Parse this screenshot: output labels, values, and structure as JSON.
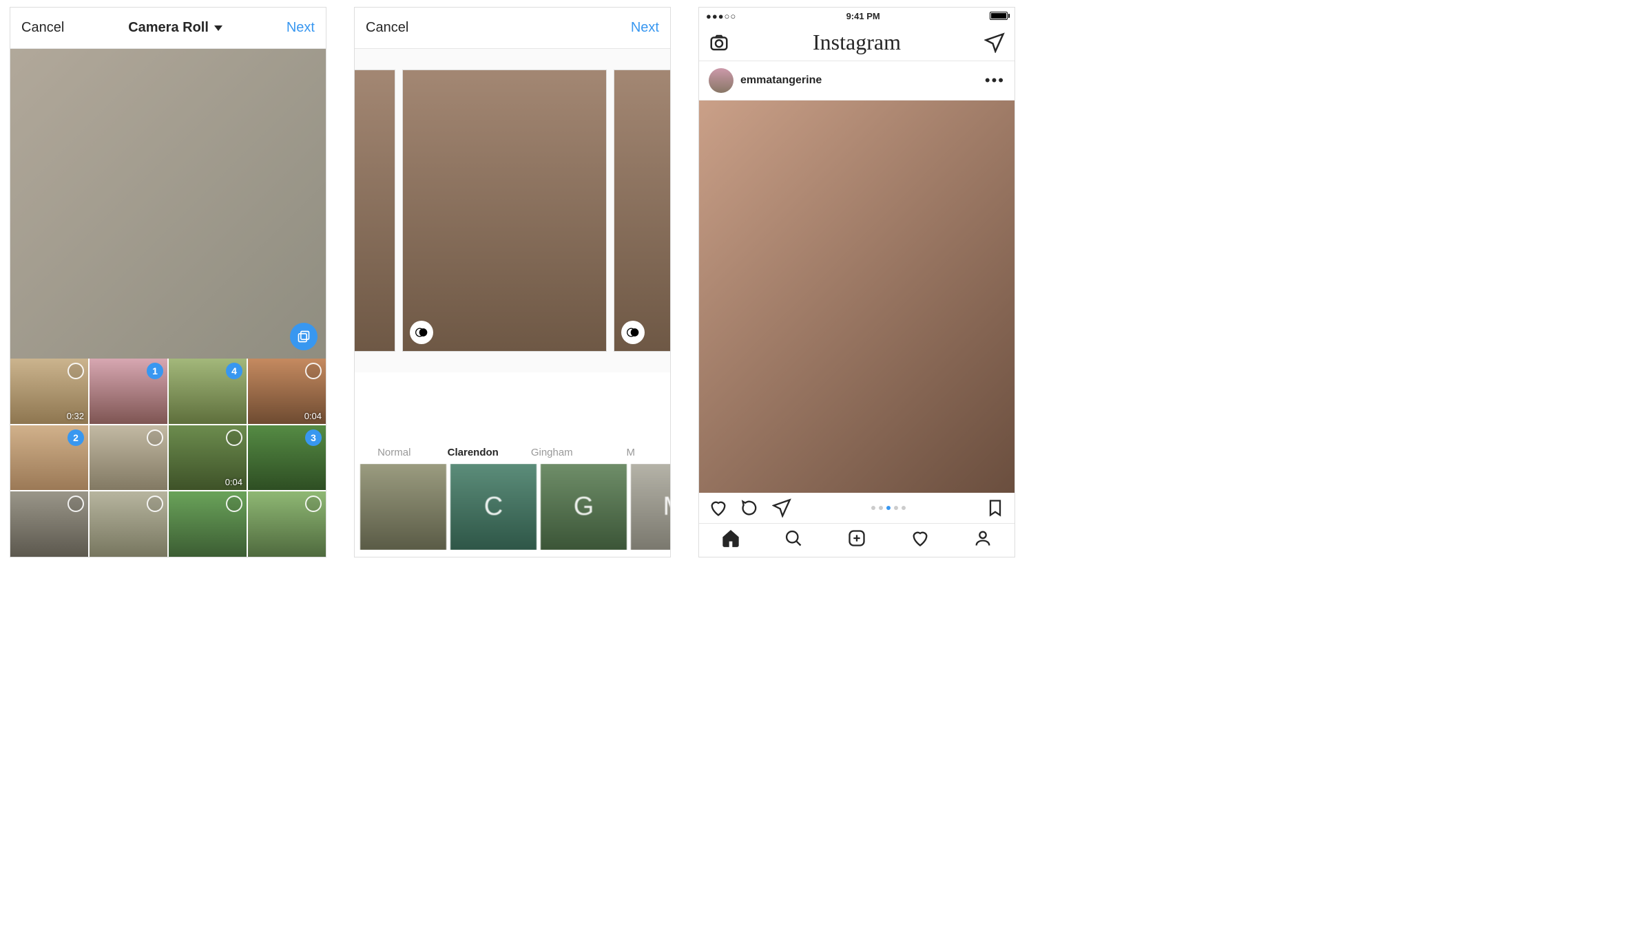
{
  "screen1": {
    "cancel": "Cancel",
    "title": "Camera Roll",
    "next": "Next",
    "grid": [
      {
        "dur": "0:32",
        "sel": null
      },
      {
        "dur": null,
        "sel": 1
      },
      {
        "dur": null,
        "sel": 4
      },
      {
        "dur": "0:04",
        "sel": null
      },
      {
        "dur": null,
        "sel": 2
      },
      {
        "dur": null,
        "sel": null
      },
      {
        "dur": "0:04",
        "sel": null
      },
      {
        "dur": null,
        "sel": 3
      },
      {
        "dur": null,
        "sel": null
      },
      {
        "dur": null,
        "sel": null
      },
      {
        "dur": null,
        "sel": null
      },
      {
        "dur": null,
        "sel": null
      }
    ]
  },
  "screen2": {
    "cancel": "Cancel",
    "next": "Next",
    "filters": [
      {
        "label": "Normal",
        "glyph": ""
      },
      {
        "label": "Clarendon",
        "glyph": "C"
      },
      {
        "label": "Gingham",
        "glyph": "G"
      },
      {
        "label": "M",
        "glyph": "M"
      }
    ],
    "active_filter_index": 1
  },
  "screen3": {
    "status_time": "9:41 PM",
    "signal_dots": "●●●○○",
    "app_name": "Instagram",
    "username": "emmatangerine",
    "more": "•••",
    "carousel_count": 5,
    "carousel_active": 3
  }
}
